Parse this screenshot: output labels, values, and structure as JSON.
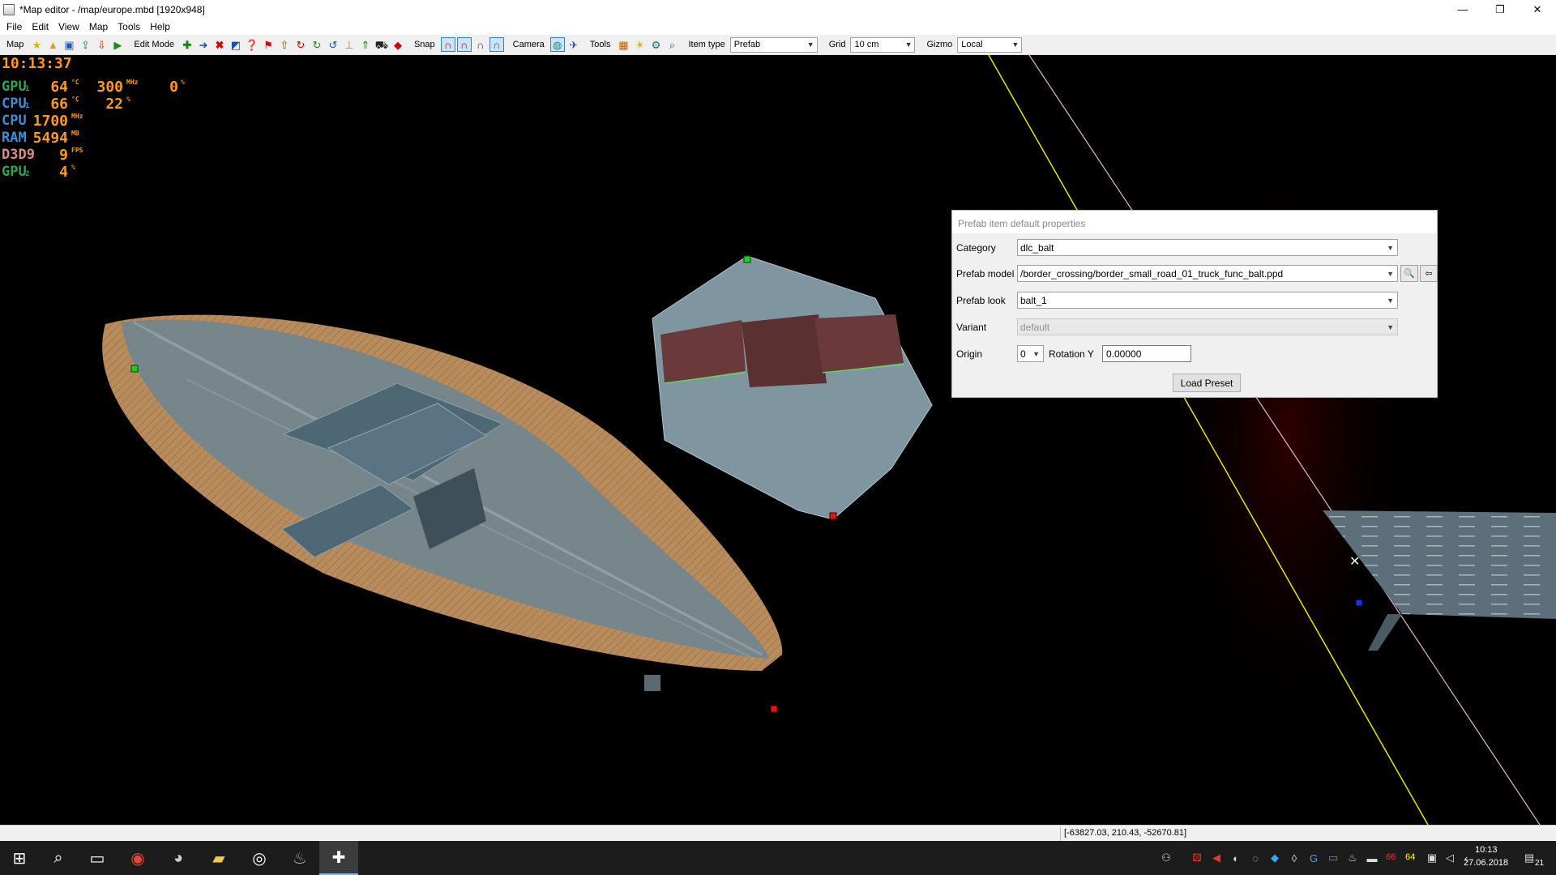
{
  "window": {
    "title": "*Map editor - /map/europe.mbd [1920x948]",
    "controls": [
      "—",
      "❐",
      "✕"
    ]
  },
  "menu": [
    "File",
    "Edit",
    "View",
    "Map",
    "Tools",
    "Help"
  ],
  "toolbar": {
    "map_label": "Map",
    "edit_mode_label": "Edit Mode",
    "snap_label": "Snap",
    "camera_label": "Camera",
    "tools_label": "Tools",
    "item_type_label": "Item type",
    "item_type_value": "Prefab",
    "grid_label": "Grid",
    "grid_value": "10 cm",
    "gizmo_label": "Gizmo",
    "gizmo_value": "Local",
    "map_icons": [
      "star-icon",
      "open-folder-icon",
      "save-icon",
      "export-icon",
      "import-icon",
      "play-icon"
    ],
    "edit_icons": [
      "add-icon",
      "move-icon",
      "delete-icon",
      "properties-icon",
      "help-circle-icon",
      "flag-icon",
      "marker-icon",
      "rotate-icon",
      "refresh-icon",
      "cycle-icon",
      "stamp-icon",
      "raise-icon",
      "vehicles-icon",
      "car-icon"
    ],
    "snap_icons": [
      "magnet-icon",
      "magnet-alt-icon",
      "magnet-off-icon",
      "magnet-grid-icon"
    ],
    "camera_icons": [
      "globe-icon",
      "bird-icon"
    ],
    "tool_icons": [
      "palette-icon",
      "sun-icon",
      "gear-icon",
      "search-icon"
    ]
  },
  "hud": {
    "clock": "10:13:37",
    "rows": [
      {
        "name": "GPU",
        "sub": "1",
        "color": "#2aa84a",
        "v1": "64",
        "u1": "°C",
        "v2": "300",
        "u2": "MHz",
        "v3": "0",
        "u3": "%"
      },
      {
        "name": "CPU",
        "sub": "1",
        "color": "#3a8fd8",
        "v1": "66",
        "u1": "°C",
        "v2": "22",
        "u2": "%",
        "v3": "",
        "u3": ""
      },
      {
        "name": "CPU",
        "sub": "",
        "color": "#3a8fd8",
        "v1": "1700",
        "u1": "MHz",
        "v2": "",
        "u2": "",
        "v3": "",
        "u3": ""
      },
      {
        "name": "RAM",
        "sub": "",
        "color": "#3a8fd8",
        "v1": "5494",
        "u1": "MB",
        "v2": "",
        "u2": "",
        "v3": "",
        "u3": ""
      },
      {
        "name": "D3D9",
        "sub": "",
        "color": "#d98a8a",
        "v1": "9",
        "u1": "FPS",
        "v2": "",
        "u2": "",
        "v3": "",
        "u3": ""
      },
      {
        "name": "GPU",
        "sub": "2",
        "color": "#2aa84a",
        "v1": "4",
        "u1": "%",
        "v2": "",
        "u2": "",
        "v3": "",
        "u3": ""
      }
    ]
  },
  "prefab_panel": {
    "title": "Prefab item default properties",
    "category_label": "Category",
    "category_value": "dlc_balt",
    "model_label": "Prefab model",
    "model_value": "/border_crossing/border_small_road_01_truck_func_balt.ppd",
    "look_label": "Prefab look",
    "look_value": "balt_1",
    "variant_label": "Variant",
    "variant_value": "default",
    "origin_label": "Origin",
    "origin_value": "0",
    "rotation_label": "Rotation Y",
    "rotation_value": "0.00000",
    "load_preset_label": "Load Preset"
  },
  "status": {
    "coords": "[-63827.03, 210.43, -52670.81]"
  },
  "taskbar": {
    "apps": [
      "windows-start-icon",
      "search-icon",
      "task-view-icon",
      "chrome-icon",
      "mouse-app-icon",
      "file-explorer-icon",
      "media-player-icon",
      "steam-icon",
      "map-editor-icon"
    ],
    "tray_temp_a": "66",
    "tray_temp_b": "64",
    "time": "10:13",
    "date": "27.06.2018",
    "notifications": "21"
  }
}
